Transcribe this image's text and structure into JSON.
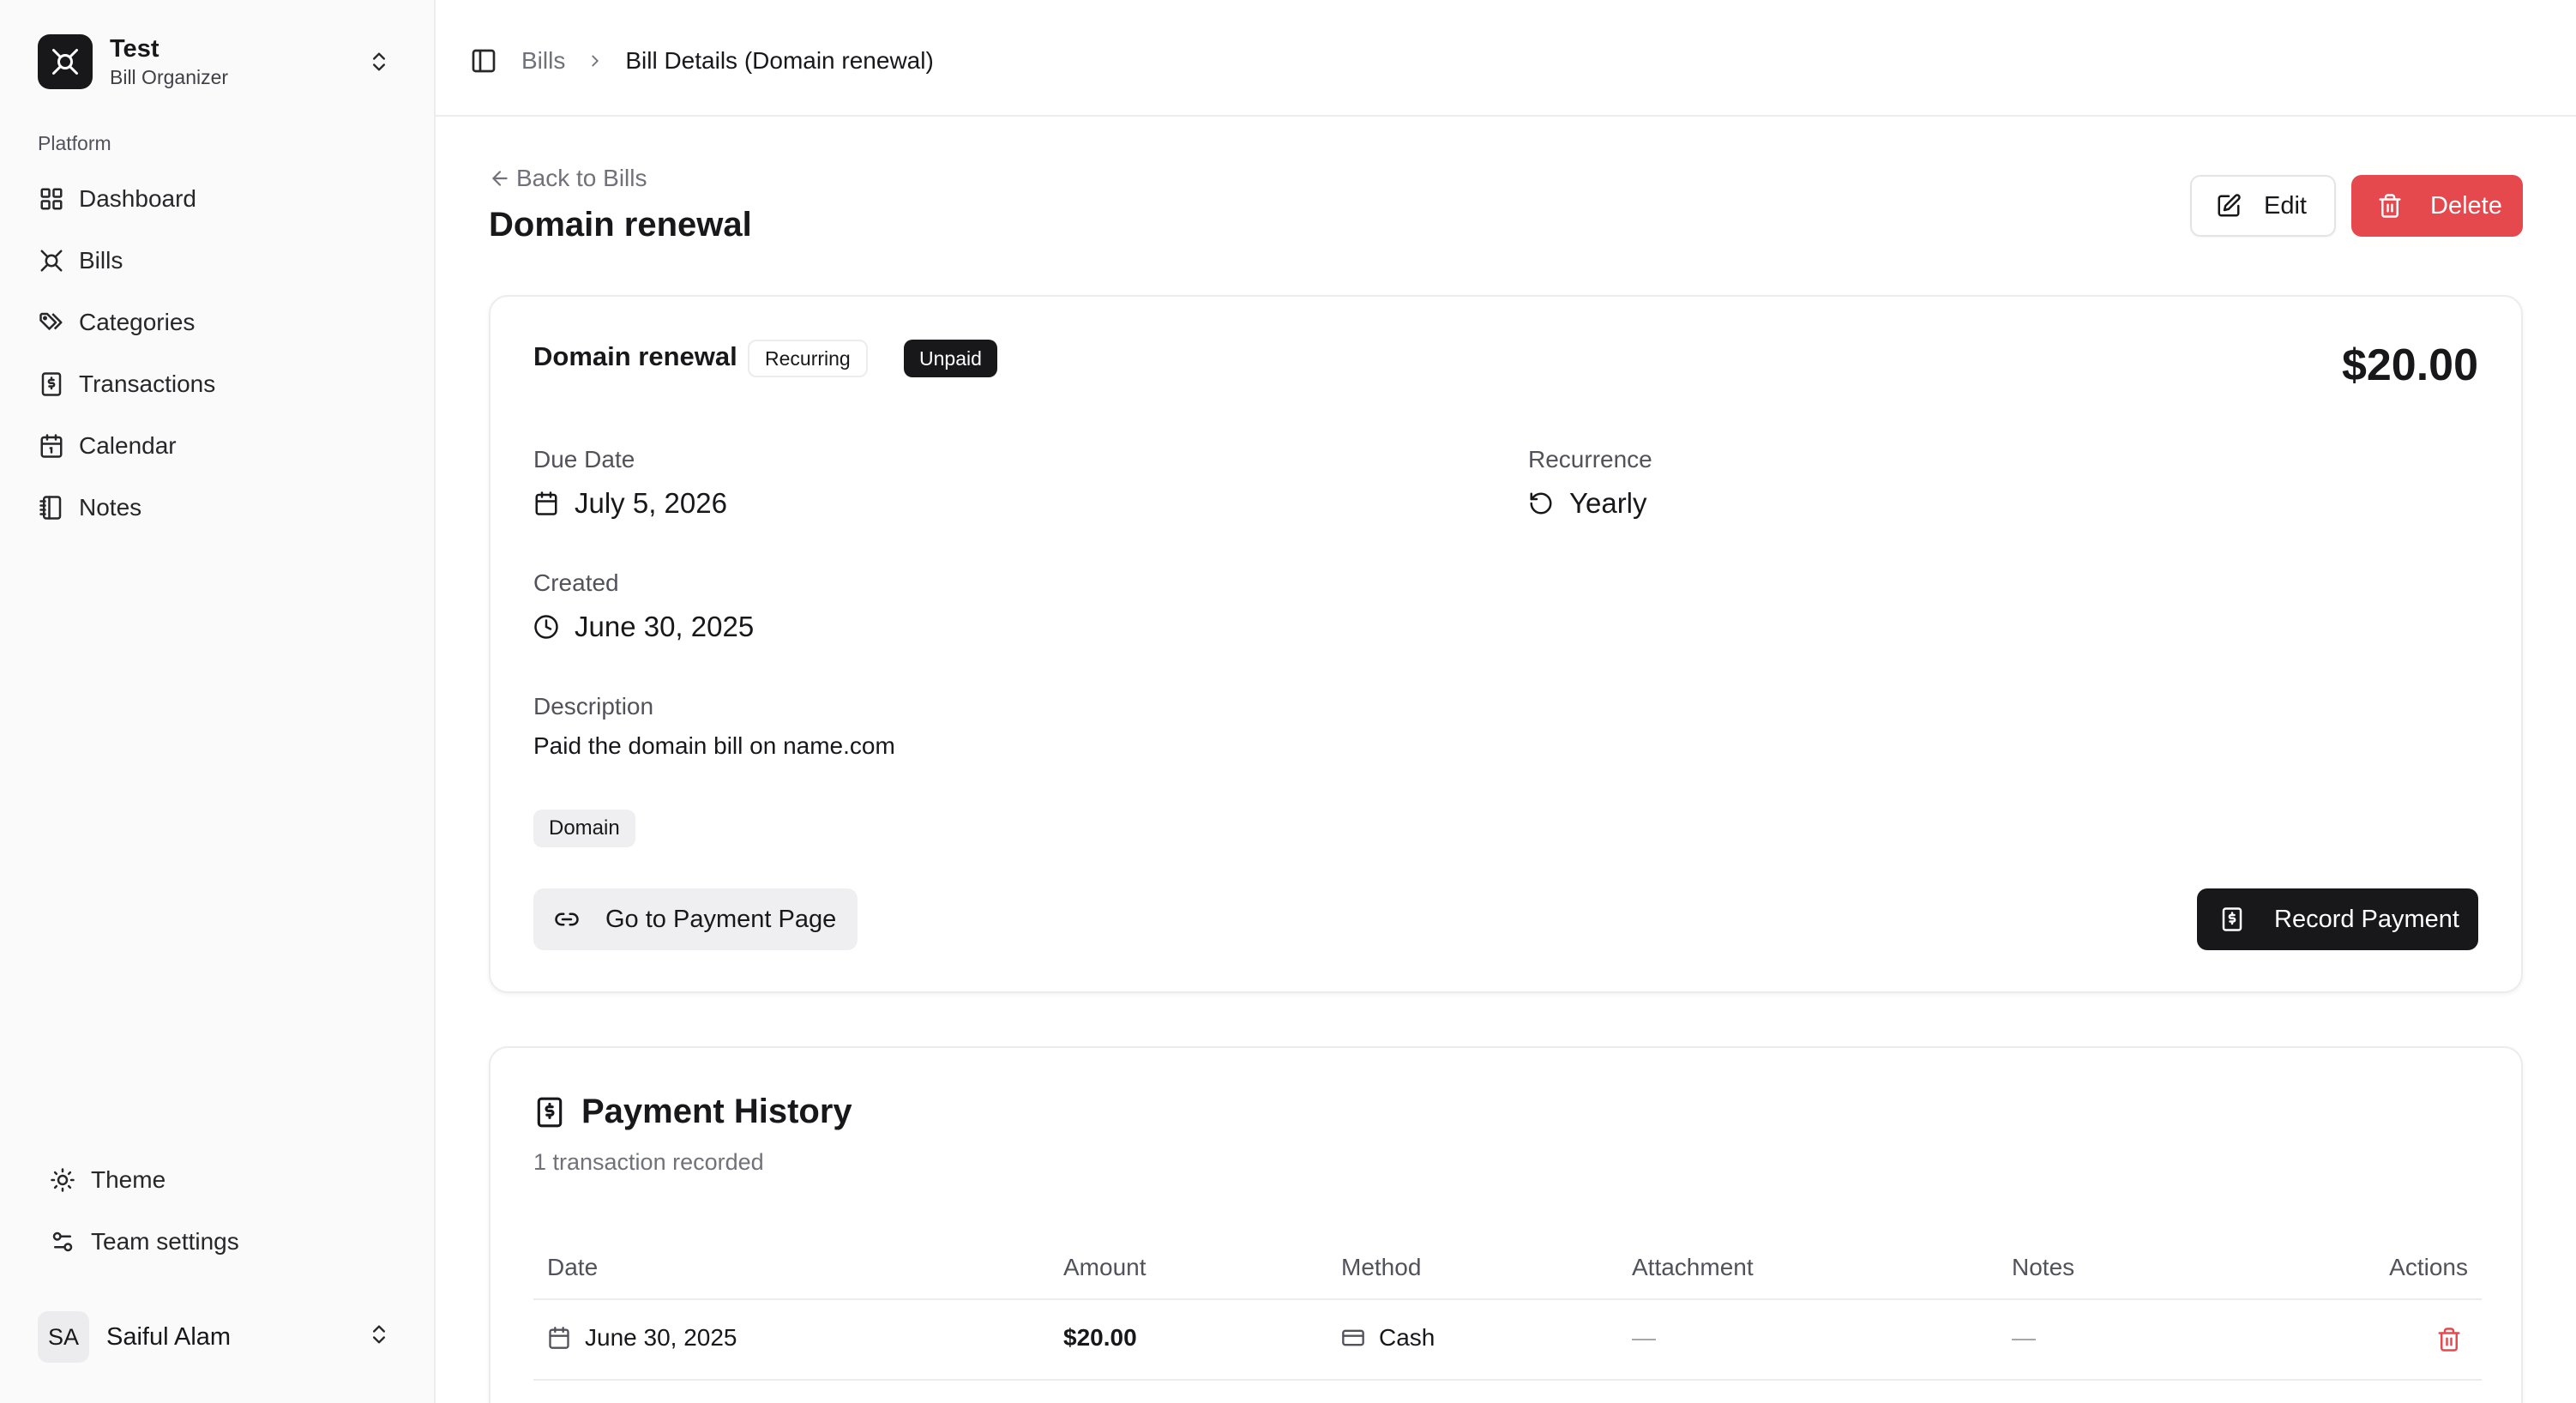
{
  "sidebar": {
    "team": {
      "name": "Test",
      "subtitle": "Bill Organizer"
    },
    "group_label": "Platform",
    "items": [
      {
        "label": "Dashboard",
        "icon": "layout-grid-icon"
      },
      {
        "label": "Bills",
        "icon": "bills-icon"
      },
      {
        "label": "Categories",
        "icon": "tags-icon"
      },
      {
        "label": "Transactions",
        "icon": "receipt-icon"
      },
      {
        "label": "Calendar",
        "icon": "calendar-icon"
      },
      {
        "label": "Notes",
        "icon": "notebook-icon"
      }
    ],
    "footer": [
      {
        "label": "Theme",
        "icon": "sun-icon"
      },
      {
        "label": "Team settings",
        "icon": "settings-sliders-icon"
      }
    ],
    "user": {
      "initials": "SA",
      "name": "Saiful Alam"
    }
  },
  "breadcrumb": {
    "parent": "Bills",
    "current": "Bill Details (Domain renewal)"
  },
  "header": {
    "back_label": "Back to Bills",
    "title": "Domain renewal",
    "edit_label": "Edit",
    "delete_label": "Delete"
  },
  "bill": {
    "name": "Domain renewal",
    "badge_recurring": "Recurring",
    "badge_status": "Unpaid",
    "amount": "$20.00",
    "due_date_label": "Due Date",
    "due_date": "July 5, 2026",
    "recurrence_label": "Recurrence",
    "recurrence": "Yearly",
    "created_label": "Created",
    "created": "June 30, 2025",
    "description_label": "Description",
    "description": "Paid the domain bill on name.com",
    "tag": "Domain",
    "payment_page_label": "Go to Payment Page",
    "record_payment_label": "Record Payment"
  },
  "history": {
    "title": "Payment History",
    "subtitle": "1 transaction recorded",
    "columns": [
      "Date",
      "Amount",
      "Method",
      "Attachment",
      "Notes",
      "Actions"
    ],
    "rows": [
      {
        "date": "June 30, 2025",
        "amount": "$20.00",
        "method": "Cash",
        "attachment": "—",
        "notes": "—"
      }
    ]
  },
  "colors": {
    "accent_dark": "#18181b",
    "danger": "#e5484d",
    "sidebar_bg": "#fafafa"
  }
}
